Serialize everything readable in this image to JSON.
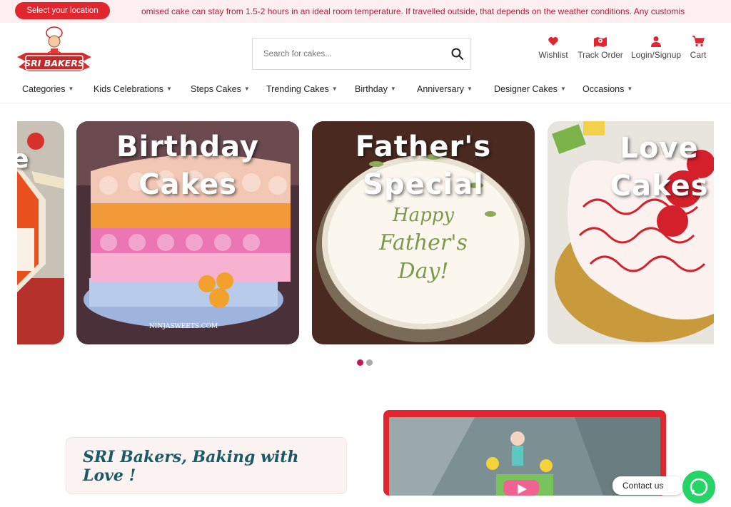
{
  "topbar": {
    "location_button": "Select your location",
    "announcement": "omised cake can stay from 1.5-2 hours in an ideal room temperature. If travelled outside, that depends on the weather conditions.     Any customis"
  },
  "header": {
    "logo_alt": "SRI BAKERS",
    "search_placeholder": "Search for cakes...",
    "icons": [
      {
        "label": "Wishlist",
        "icon": "heart-icon"
      },
      {
        "label": "Track Order",
        "icon": "map-pin-icon"
      },
      {
        "label": "Login/Signup",
        "icon": "user-icon"
      },
      {
        "label": "Cart",
        "icon": "cart-icon"
      }
    ]
  },
  "nav": {
    "items": [
      "Categories",
      "Kids Celebrations",
      "Steps Cakes",
      "Trending Cakes",
      "Birthday",
      "Anniversary",
      "Designer Cakes",
      "Occasions"
    ]
  },
  "carousel": {
    "slides": [
      {
        "title_line1": "",
        "title_line2": "e"
      },
      {
        "title_line1": "Birthday",
        "title_line2": "Cakes",
        "watermark": "NINJASWEETS.COM"
      },
      {
        "title_line1": "Father's",
        "title_line2": "Special",
        "cake_text": "Happy Father's Day!"
      },
      {
        "title_line1": "Love",
        "title_line2": "Cakes"
      }
    ],
    "active_index": 0,
    "dot_count": 2
  },
  "about": {
    "title": "SRI Bakers, Baking with Love !"
  },
  "contact": {
    "label": "Contact us"
  },
  "colors": {
    "brand_red": "#e0262f",
    "topbar_bg": "#fdeef0",
    "dot_active": "#c2185b",
    "dot_inactive": "#aaaaaa",
    "about_title": "#1a5a66",
    "whatsapp": "#25d366"
  }
}
